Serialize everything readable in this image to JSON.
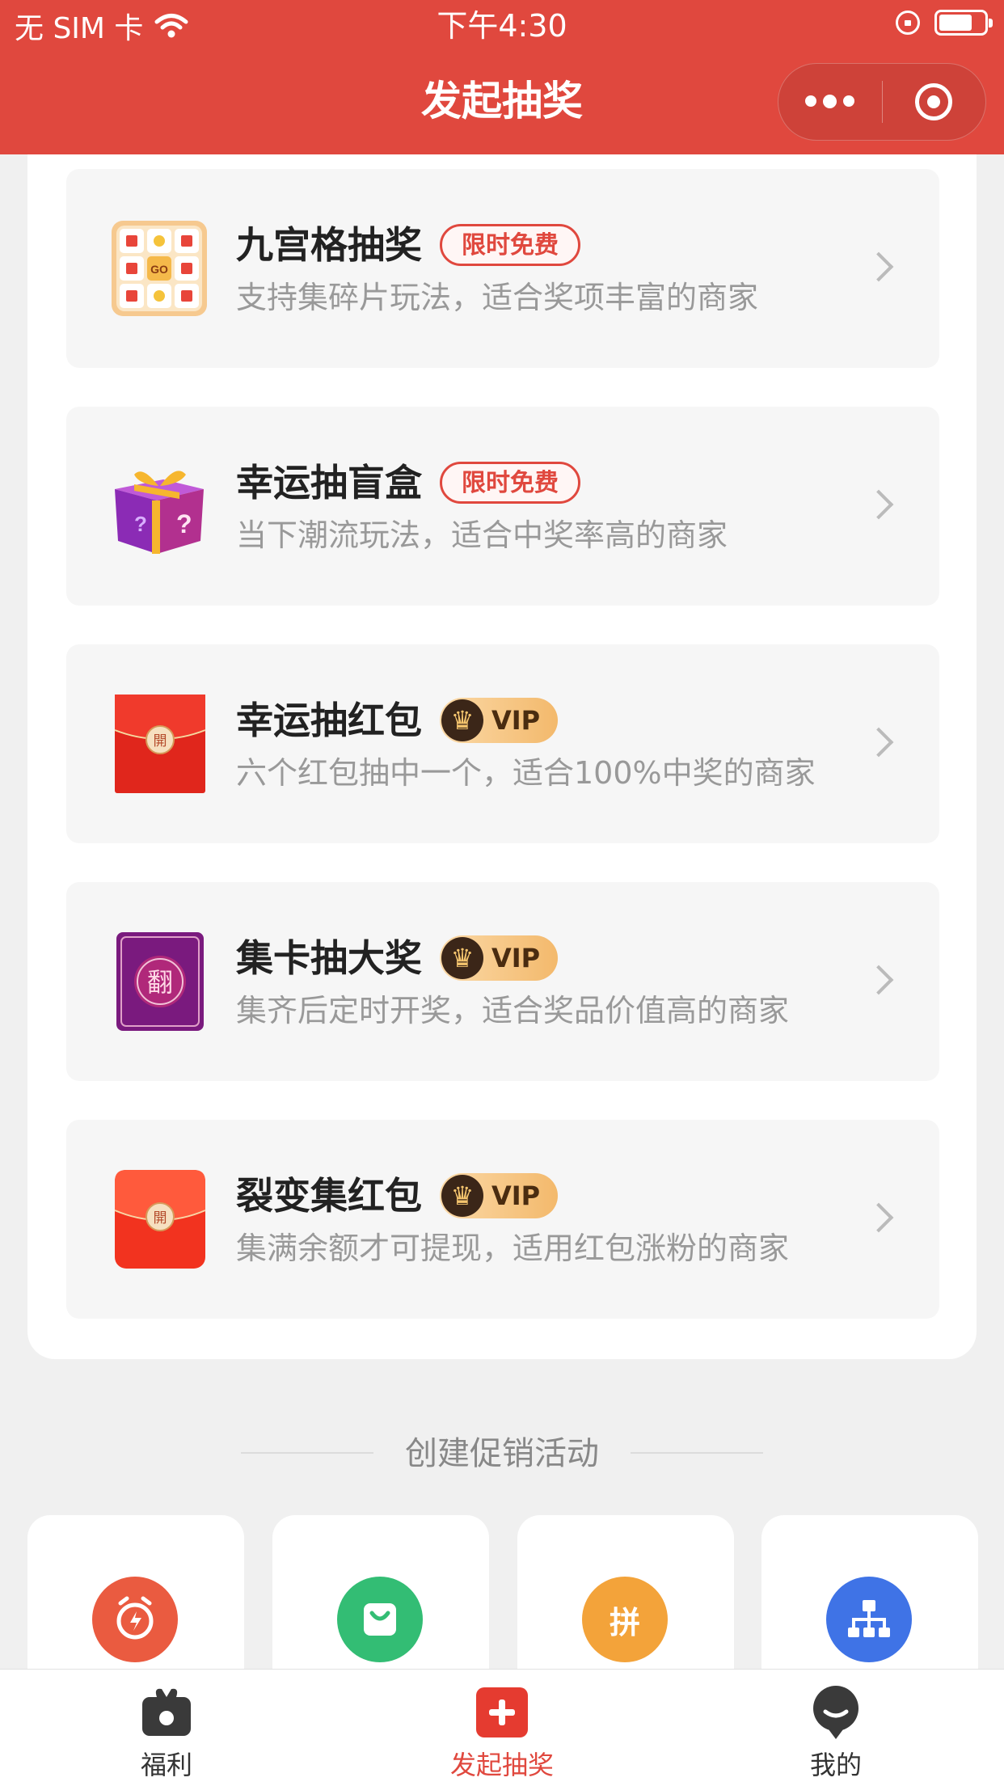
{
  "status_bar": {
    "carrier": "无 SIM 卡",
    "time": "下午4:30"
  },
  "nav": {
    "title": "发起抽奖"
  },
  "colors": {
    "brand_red": "#e0483e",
    "vip_gold": "#f3b96c"
  },
  "lottery_cards": [
    {
      "title": "九宫格抽奖",
      "badge_type": "free",
      "badge": "限时免费",
      "desc": "支持集碎片玩法，适合奖项丰富的商家",
      "icon": "nine-grid-icon"
    },
    {
      "title": "幸运抽盲盒",
      "badge_type": "free",
      "badge": "限时免费",
      "desc": "当下潮流玩法，适合中奖率高的商家",
      "icon": "gift-box-icon"
    },
    {
      "title": "幸运抽红包",
      "badge_type": "vip",
      "badge": "VIP",
      "desc": "六个红包抽中一个，适合100%中奖的商家",
      "icon": "red-envelope-icon"
    },
    {
      "title": "集卡抽大奖",
      "badge_type": "vip",
      "badge": "VIP",
      "desc": "集齐后定时开奖，适合奖品价值高的商家",
      "icon": "flip-card-icon"
    },
    {
      "title": "裂变集红包",
      "badge_type": "vip",
      "badge": "VIP",
      "desc": "集满余额才可提现，适用红包涨粉的商家",
      "icon": "red-packet-icon"
    }
  ],
  "section": {
    "title": "创建促销活动"
  },
  "promo_icons": [
    {
      "icon": "alarm-flash-icon",
      "color": "#ea5b40"
    },
    {
      "icon": "shopping-bag-icon",
      "color": "#33bd74"
    },
    {
      "icon": "group-buy-icon",
      "color": "#f3a33a",
      "glyph": "拼"
    },
    {
      "icon": "org-chart-icon",
      "color": "#3f73e6"
    }
  ],
  "tabbar": [
    {
      "label": "福利",
      "icon": "gift-icon",
      "active": false
    },
    {
      "label": "发起抽奖",
      "icon": "plus-icon",
      "active": true
    },
    {
      "label": "我的",
      "icon": "profile-icon",
      "active": false
    }
  ]
}
